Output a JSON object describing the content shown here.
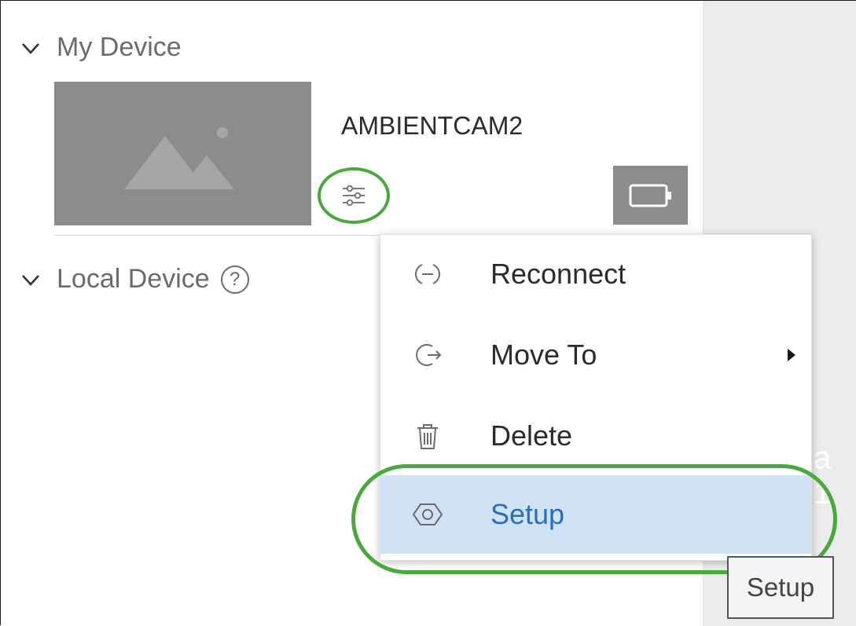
{
  "sections": {
    "my_device": {
      "label": "My Device"
    },
    "local_device": {
      "label": "Local Device",
      "help_symbol": "?"
    }
  },
  "device": {
    "name": "AMBIENTCAM2",
    "thumbnail_icon": "image-placeholder-icon",
    "settings_icon": "sliders-icon",
    "battery_icon": "battery-icon"
  },
  "context_menu": {
    "items": [
      {
        "label": "Reconnect",
        "icon": "reconnect-icon"
      },
      {
        "label": "Move To",
        "icon": "move-to-icon",
        "has_submenu": true
      },
      {
        "label": "Delete",
        "icon": "trash-icon"
      },
      {
        "label": "Setup",
        "icon": "hexagon-setup-icon",
        "selected": true
      }
    ]
  },
  "background_fragment": "a 1",
  "setup_button": {
    "label": "Setup"
  },
  "colors": {
    "highlight_green": "#4aa83f",
    "selected_bg": "#cfe3f5",
    "selected_text": "#2a6fba",
    "thumbnail_gray": "#8c8c8c"
  }
}
